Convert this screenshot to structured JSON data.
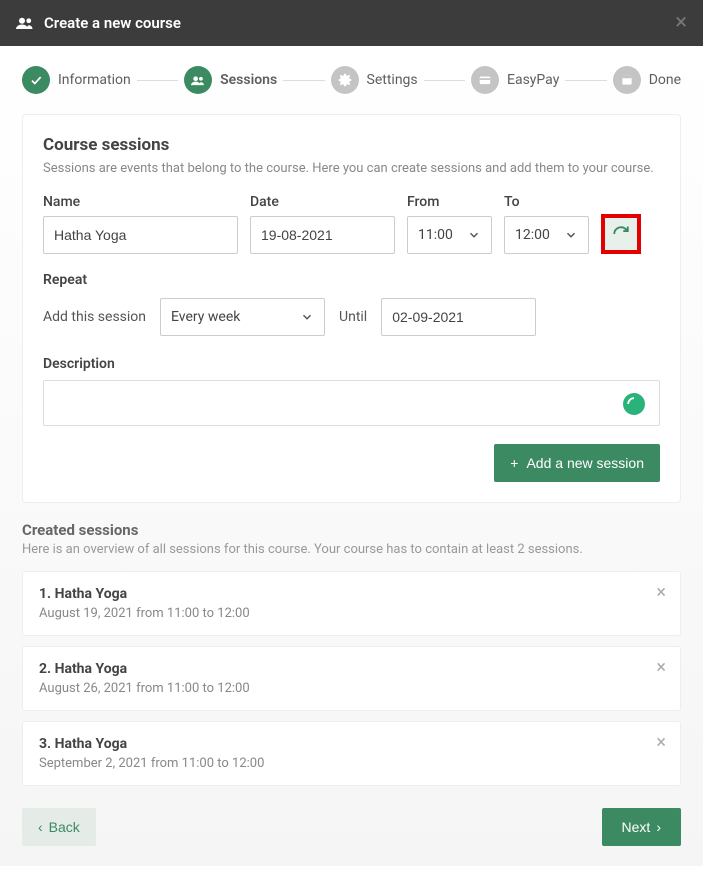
{
  "header": {
    "title": "Create a new course"
  },
  "stepper": {
    "steps": [
      {
        "label": "Information",
        "state": "done"
      },
      {
        "label": "Sessions",
        "state": "active"
      },
      {
        "label": "Settings",
        "state": "inactive"
      },
      {
        "label": "EasyPay",
        "state": "inactive"
      },
      {
        "label": "Done",
        "state": "inactive"
      }
    ]
  },
  "sessionsCard": {
    "title": "Course sessions",
    "subtitle": "Sessions are events that belong to the course. Here you can create sessions and add them to your course.",
    "nameLabel": "Name",
    "nameValue": "Hatha Yoga",
    "dateLabel": "Date",
    "dateValue": "19-08-2021",
    "fromLabel": "From",
    "fromValue": "11:00",
    "toLabel": "To",
    "toValue": "12:00",
    "repeatLabel": "Repeat",
    "addThisSessionLabel": "Add this session",
    "frequencyValue": "Every week",
    "untilLabel": "Until",
    "untilValue": "02-09-2021",
    "descriptionLabel": "Description",
    "addButtonLabel": "Add a new session"
  },
  "createdSessions": {
    "title": "Created sessions",
    "subtitle": "Here is an overview of all sessions for this course. Your course has to contain at least 2 sessions.",
    "items": [
      {
        "title": "1. Hatha Yoga",
        "detail": "August 19, 2021 from 11:00 to 12:00"
      },
      {
        "title": "2. Hatha Yoga",
        "detail": "August 26, 2021 from 11:00 to 12:00"
      },
      {
        "title": "3. Hatha Yoga",
        "detail": "September 2, 2021 from 11:00 to 12:00"
      }
    ]
  },
  "footer": {
    "backLabel": "Back",
    "nextLabel": "Next"
  }
}
